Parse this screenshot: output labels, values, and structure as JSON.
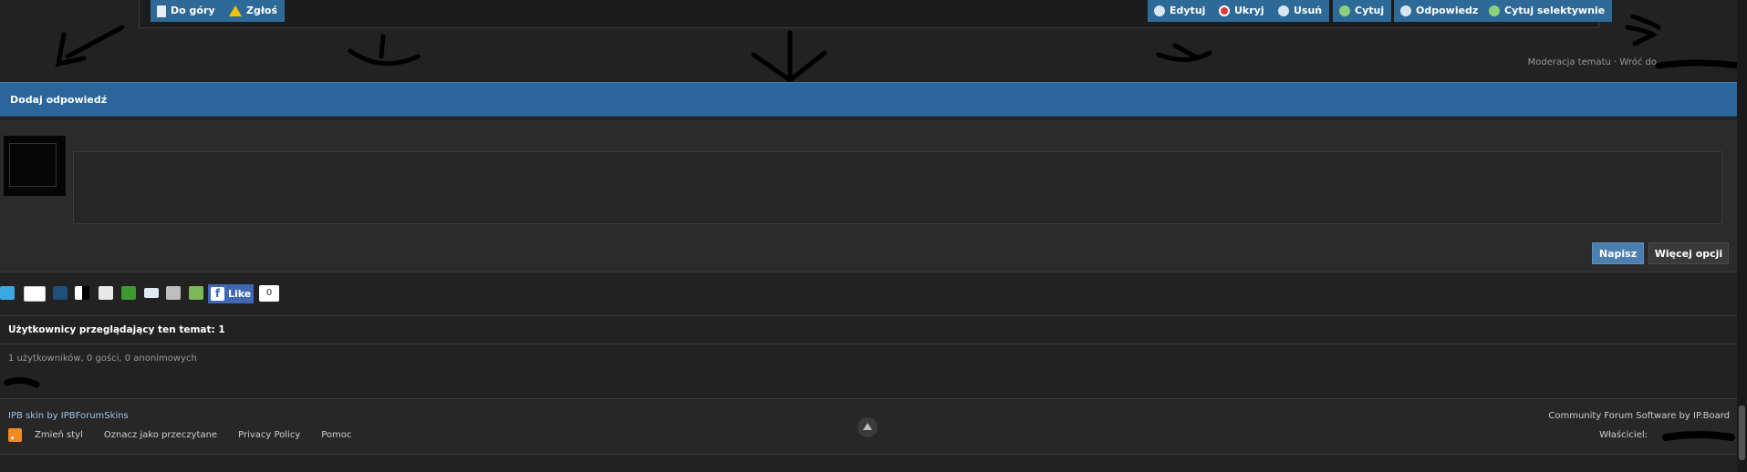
{
  "post_bar": {
    "left_buttons": [
      {
        "label": "Do góry",
        "icon": "document-icon"
      },
      {
        "label": "Zgłoś",
        "icon": "warning-icon"
      }
    ],
    "right_buttons": [
      {
        "label": "Edytuj",
        "icon": "speech-bubble-icon"
      },
      {
        "label": "Ukryj",
        "icon": "stop-icon"
      },
      {
        "label": "Usuń",
        "icon": "speech-bubble-icon"
      },
      {
        "label": "Cytuj",
        "icon": "quote-bubble-icon"
      },
      {
        "label": "Odpowiedz",
        "icon": "speech-bubble-icon"
      },
      {
        "label": "Cytuj selektywnie",
        "icon": "quote-bubble-icon"
      }
    ]
  },
  "meta_links": "Moderacja tematu · Wróć do",
  "reply": {
    "header": "Dodaj odpowiedź",
    "submit_label": "Napisz",
    "more_label": "Więcej opcji"
  },
  "share": {
    "icons": [
      "twitter-icon",
      "google-plus-icon",
      "digg-icon",
      "delicious-icon",
      "reddit-icon",
      "stumbleupon-icon",
      "email-icon",
      "print-icon",
      "download-icon"
    ],
    "fb_like_label": "Like",
    "fb_like_count": "0"
  },
  "viewers": {
    "title": "Użytkownicy przeglądający ten temat: 1",
    "count": "1 użytkowników, 0 gości, 0 anonimowych"
  },
  "footer": {
    "skin_credit": "IPB skin by IPBForumSkins",
    "links": [
      "Zmień styl",
      "Oznacz jako przeczytane",
      "Privacy Policy",
      "Pomoc"
    ],
    "software_credit": "Community Forum Software by IP.Board",
    "owner_label": "Właściciel:"
  },
  "colors": {
    "background": "#222222",
    "accent_blue": "#2a6699",
    "button_blue": "#2d6a98"
  }
}
